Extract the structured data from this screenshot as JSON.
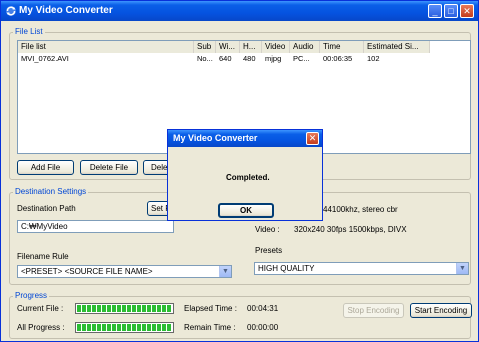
{
  "window": {
    "title": "My Video Converter",
    "min_glyph": "_",
    "max_glyph": "□",
    "close_glyph": "✕"
  },
  "file_list": {
    "group_label": "File List",
    "columns": [
      "File list",
      "Sub",
      "Wi...",
      "H...",
      "Video",
      "Audio",
      "Time",
      "Estimated Si..."
    ],
    "rows": [
      [
        "MVI_0762.AVI",
        "No...",
        "640",
        "480",
        "mjpg",
        "PC...",
        "00:06:35",
        "102"
      ]
    ],
    "add_file_label": "Add File",
    "delete_file_label": "Delete File",
    "delete_partial_label": "Dele"
  },
  "destination": {
    "group_label": "Destination Settings",
    "path_label": "Destination Path",
    "set_button_label": "Set F",
    "path_value": "C:₩MyVideo",
    "filename_rule_label": "Filename Rule",
    "filename_rule_value": "<PRESET> <SOURCE FILE NAME>",
    "audio_info": "44100khz, stereo cbr",
    "video_label": "Video :",
    "video_info": "320x240 30fps 1500kbps, DIVX",
    "presets_label": "Presets",
    "presets_value": "HIGH QUALITY"
  },
  "progress": {
    "group_label": "Progress",
    "current_file_label": "Current File :",
    "all_progress_label": "All Progress :",
    "current_file_fraction": 1.0,
    "all_progress_fraction": 1.0,
    "elapsed_label": "Elapsed Time :",
    "elapsed_value": "00:04:31",
    "remain_label": "Remain Time :",
    "remain_value": "00:00:00",
    "stop_label": "Stop Encoding",
    "start_label": "Start Encoding"
  },
  "dialog": {
    "title": "My Video Converter",
    "close_glyph": "✕",
    "message": "Completed.",
    "ok_label": "OK"
  },
  "icons": {
    "app_icon": "refresh-arrows-icon",
    "combo_arrow": "chevron-down-icon"
  },
  "colors": {
    "titlebar_blue": "#0553e0",
    "group_label_blue": "#0046d5",
    "progress_green": "#2bbd33",
    "close_red": "#c43c1c"
  }
}
